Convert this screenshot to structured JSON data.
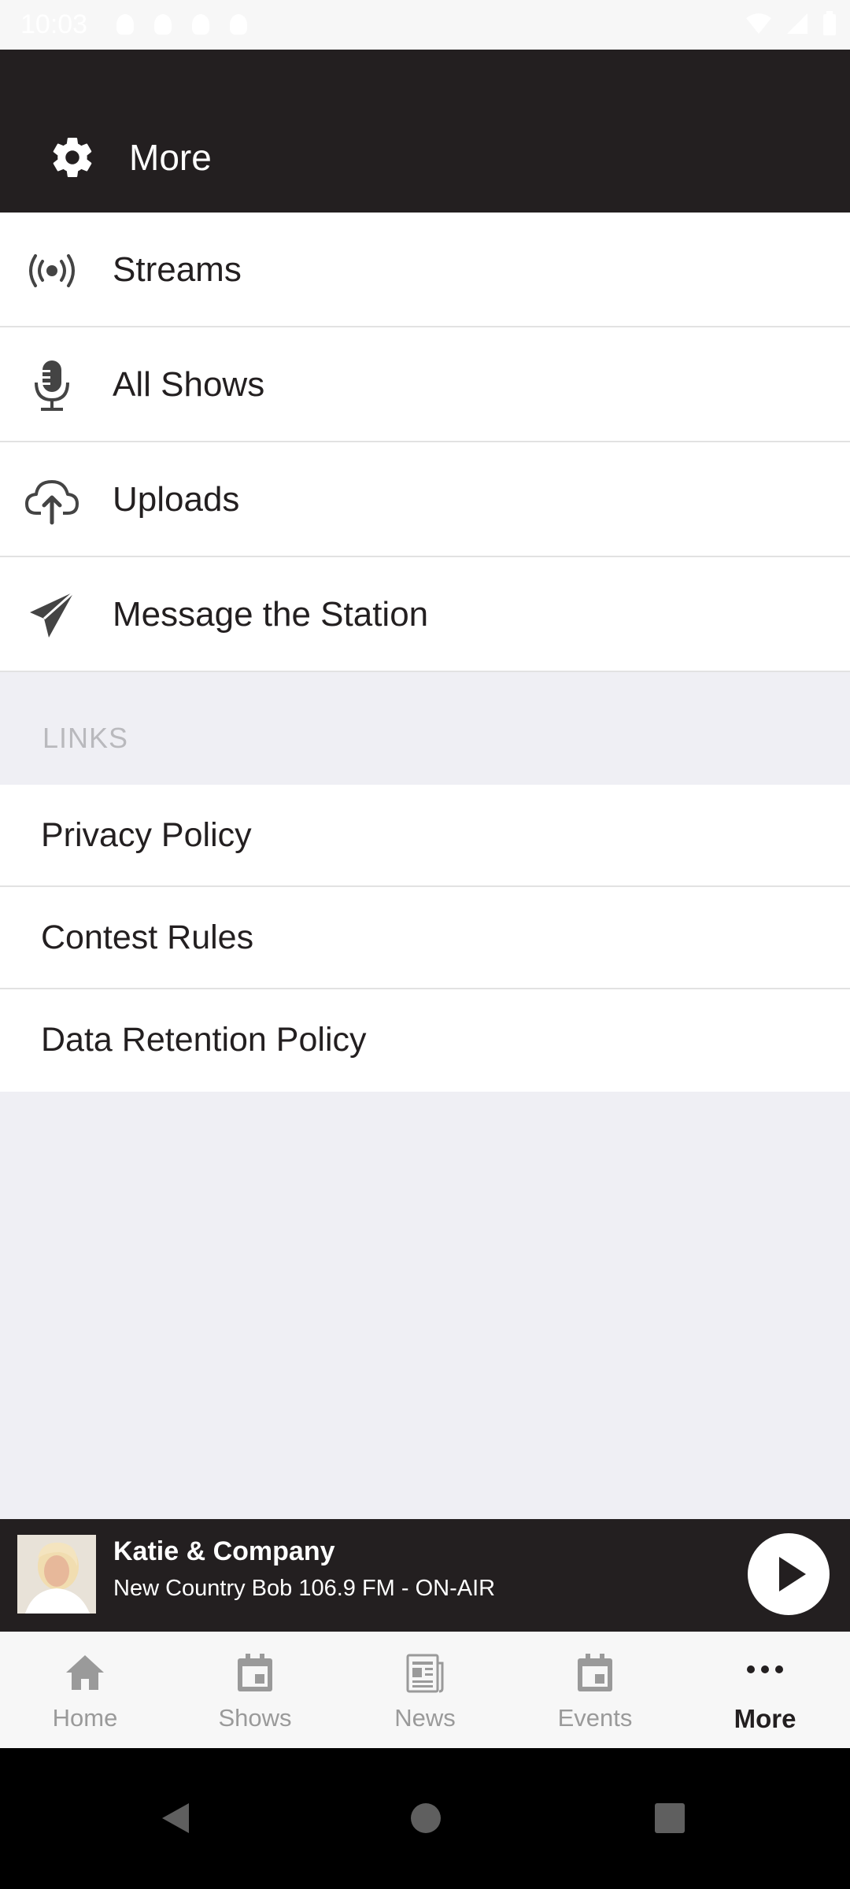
{
  "status_bar": {
    "time": "10:03"
  },
  "header": {
    "title": "More",
    "icon": "gear-icon"
  },
  "menu": [
    {
      "label": "Streams",
      "icon": "broadcast-icon"
    },
    {
      "label": "All Shows",
      "icon": "microphone-icon"
    },
    {
      "label": "Uploads",
      "icon": "cloud-upload-icon"
    },
    {
      "label": "Message the Station",
      "icon": "paper-plane-icon"
    }
  ],
  "links_section": {
    "title": "LINKS",
    "items": [
      {
        "label": "Privacy Policy"
      },
      {
        "label": "Contest Rules"
      },
      {
        "label": "Data Retention Policy"
      }
    ]
  },
  "player": {
    "title": "Katie & Company",
    "subtitle": "New Country Bob 106.9 FM - ON-AIR",
    "play_icon": "play-icon"
  },
  "tabs": [
    {
      "label": "Home",
      "icon": "home-icon",
      "active": false
    },
    {
      "label": "Shows",
      "icon": "calendar-icon",
      "active": false
    },
    {
      "label": "News",
      "icon": "newspaper-icon",
      "active": false
    },
    {
      "label": "Events",
      "icon": "calendar-icon",
      "active": false
    },
    {
      "label": "More",
      "icon": "more-dots-icon",
      "active": true
    }
  ],
  "colors": {
    "header_bg": "#231f20",
    "page_bg": "#efeff4",
    "text_primary": "#231f20",
    "tab_inactive": "#9a9a9a"
  }
}
